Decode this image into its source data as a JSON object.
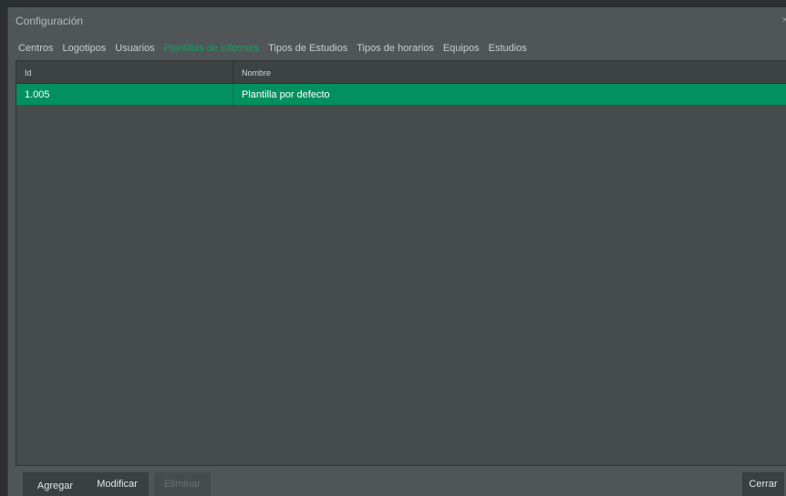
{
  "window": {
    "title": "Configuración",
    "close_glyph": "×"
  },
  "tabs": [
    {
      "label": "Centros"
    },
    {
      "label": "Logotipos"
    },
    {
      "label": "Usuarios"
    },
    {
      "label": "Plantillas de informes",
      "active": true
    },
    {
      "label": "Tipos de Estudios"
    },
    {
      "label": "Tipos de horarios"
    },
    {
      "label": "Equipos"
    },
    {
      "label": "Estudios"
    }
  ],
  "table": {
    "columns": [
      "Id",
      "Nombre"
    ],
    "rows": [
      {
        "id": "1.005",
        "nombre": "Plantilla por defecto",
        "selected": true
      }
    ]
  },
  "buttons": {
    "agregar": "Agregar",
    "modificar": "Modificar",
    "eliminar": "Eliminar",
    "cerrar": "Cerrar"
  },
  "colors": {
    "accent": "#029060",
    "active_tab": "#14a064",
    "background": "#505657"
  },
  "icons": {
    "close": "close-icon"
  }
}
